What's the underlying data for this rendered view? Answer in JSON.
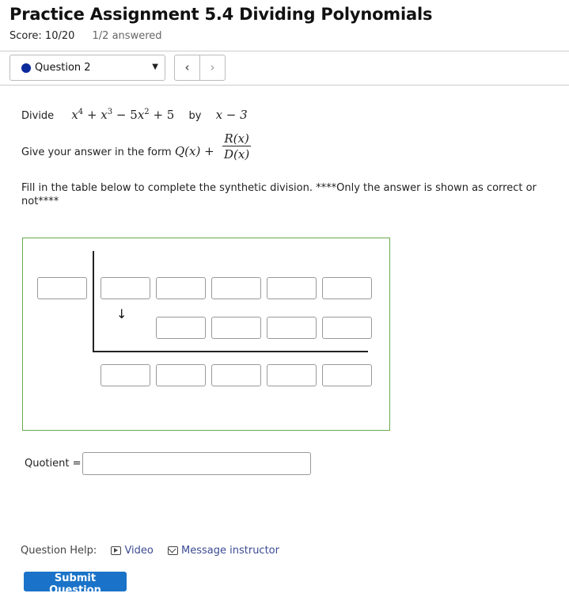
{
  "header": {
    "title": "Practice Assignment 5.4 Dividing Polynomials",
    "score": "Score: 10/20",
    "answered": "1/2 answered"
  },
  "question_nav": {
    "selected": "Question 2",
    "prev_symbol": "‹",
    "next_symbol": "›"
  },
  "problem": {
    "divide_word": "Divide",
    "by_word": "by",
    "divisor": "x − 3",
    "form_prompt": "Give your answer in the form",
    "form_q": "Q(x) +",
    "form_num": "R(x)",
    "form_den": "D(x)",
    "instructions": "Fill in the table below to complete the synthetic division.   ****Only the answer is shown as correct  or not****"
  },
  "synthetic_table": {
    "row1_cells": [
      "",
      "",
      "",
      "",
      "",
      ""
    ],
    "row2_cells": [
      "",
      "",
      "",
      ""
    ],
    "row3_cells": [
      "",
      "",
      "",
      "",
      ""
    ],
    "arrow_symbol": "↓"
  },
  "quotient": {
    "label": "Quotient =",
    "value": ""
  },
  "help": {
    "label": "Question Help:",
    "video": "Video",
    "message": "Message instructor"
  },
  "submit_label": "Submit Question",
  "colors": {
    "question_dot": "#0b2a9b",
    "table_border": "#6aa84f",
    "submit_bg": "#1a73c8",
    "link": "#3b4b93"
  }
}
